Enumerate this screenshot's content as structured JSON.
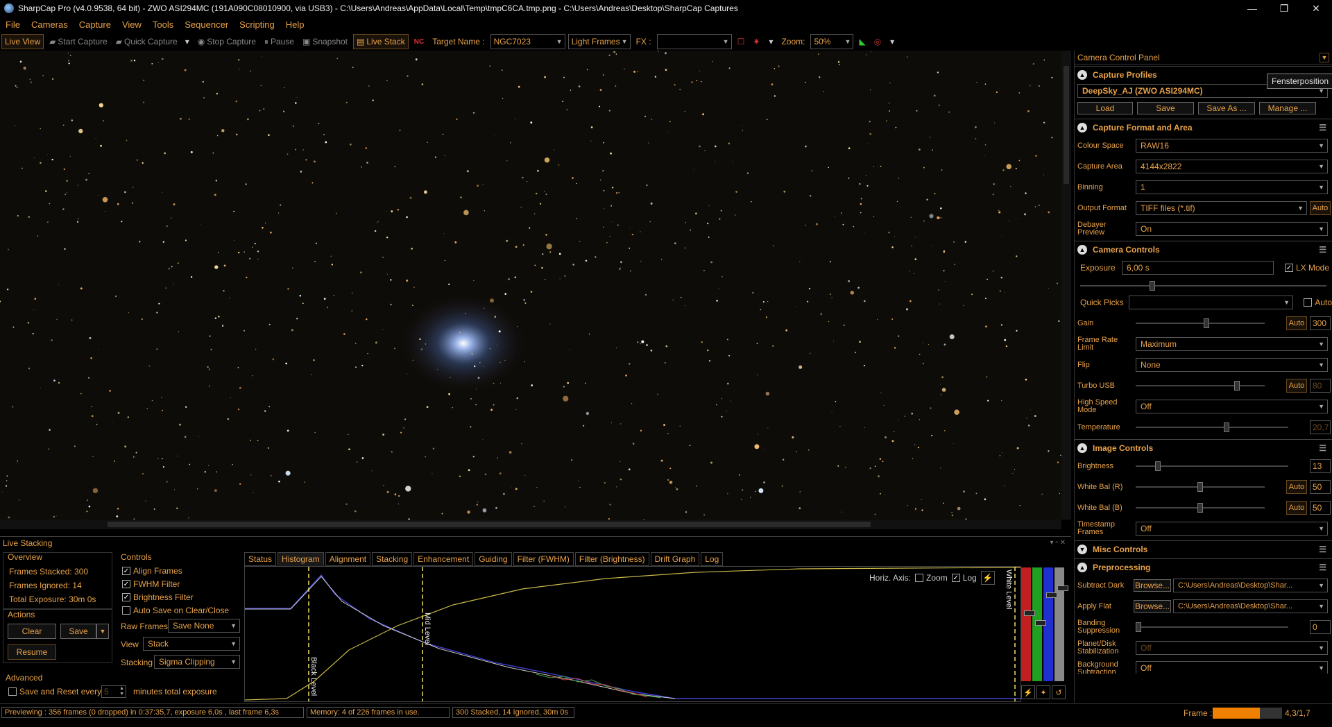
{
  "title": "SharpCap Pro (v4.0.9538, 64 bit) - ZWO ASI294MC (191A090C08010900, via USB3) - C:\\Users\\Andreas\\AppData\\Local\\Temp\\tmpC6CA.tmp.png - C:\\Users\\Andreas\\Desktop\\SharpCap Captures",
  "window_controls": [
    "—",
    "❐",
    "✕"
  ],
  "menu": [
    "File",
    "Cameras",
    "Capture",
    "View",
    "Tools",
    "Sequencer",
    "Scripting",
    "Help"
  ],
  "toolbar": {
    "live_view": "Live View",
    "start_capture": "Start Capture",
    "quick_capture": "Quick Capture",
    "stop_capture": "Stop Capture",
    "pause": "Pause",
    "snapshot": "Snapshot",
    "live_stack": "Live Stack",
    "target_name_label": "Target Name :",
    "target_name_value": "NGC7023",
    "frame_type": "Light Frames",
    "fx_label": "FX :",
    "fx_value": "",
    "zoom_label": "Zoom:",
    "zoom_value": "50%"
  },
  "camera_panel": {
    "header": "Camera Control Panel",
    "tooltip": "Fensterposition",
    "capture_profiles": {
      "title": "Capture Profiles",
      "profile": "DeepSky_AJ (ZWO ASI294MC)",
      "buttons": [
        "Load",
        "Save",
        "Save As ...",
        "Manage ..."
      ]
    },
    "capture_format": {
      "title": "Capture Format and Area",
      "colour_space_label": "Colour Space",
      "colour_space": "RAW16",
      "capture_area_label": "Capture Area",
      "capture_area": "4144x2822",
      "binning_label": "Binning",
      "binning": "1",
      "output_format_label": "Output Format",
      "output_format": "TIFF files (*.tif)",
      "output_auto": "Auto",
      "debayer_label": "Debayer Preview",
      "debayer": "On"
    },
    "camera_controls": {
      "title": "Camera Controls",
      "exposure_label": "Exposure",
      "exposure": "6,00 s",
      "lx_mode": "LX Mode",
      "quick_picks_label": "Quick Picks",
      "quick_picks": "",
      "quick_auto": "Auto",
      "gain_label": "Gain",
      "gain_auto": "Auto",
      "gain": "300",
      "gain_level": 0.55,
      "frame_rate_label": "Frame Rate Limit",
      "frame_rate": "Maximum",
      "flip_label": "Flip",
      "flip": "None",
      "turbo_label": "Turbo USB",
      "turbo_auto": "Auto",
      "turbo": "80",
      "turbo_level": 0.8,
      "high_speed_label": "High Speed Mode",
      "high_speed": "Off",
      "temperature_label": "Temperature",
      "temperature": "20,7",
      "temperature_level": 0.6
    },
    "image_controls": {
      "title": "Image Controls",
      "brightness_label": "Brightness",
      "brightness": "13",
      "brightness_level": 0.13,
      "wb_r_label": "White Bal (R)",
      "wb_r_auto": "Auto",
      "wb_r": "50",
      "wb_r_level": 0.5,
      "wb_b_label": "White Bal (B)",
      "wb_b_auto": "Auto",
      "wb_b": "50",
      "wb_b_level": 0.5,
      "timestamp_label": "Timestamp Frames",
      "timestamp": "Off"
    },
    "misc_controls": {
      "title": "Misc Controls"
    },
    "preprocessing": {
      "title": "Preprocessing",
      "subtract_dark_label": "Subtract Dark",
      "browse": "Browse...",
      "dark_path": "C:\\Users\\Andreas\\Desktop\\Shar...",
      "apply_flat_label": "Apply Flat",
      "flat_path": "C:\\Users\\Andreas\\Desktop\\Shar...",
      "banding_label": "Banding Suppression",
      "banding": "0",
      "planet_label": "Planet/Disk Stabilization",
      "planet": "Off",
      "background_label": "Background Subtraction",
      "background": "Off"
    }
  },
  "live_stacking": {
    "title": "Live Stacking",
    "overview": {
      "title": "Overview",
      "frames_stacked_label": "Frames Stacked:",
      "frames_stacked": "300",
      "frames_ignored_label": "Frames Ignored:",
      "frames_ignored": "14",
      "total_exposure_label": "Total Exposure:",
      "total_exposure": "30m 0s"
    },
    "actions": {
      "title": "Actions",
      "clear": "Clear",
      "save": "Save",
      "resume": "Resume"
    },
    "advanced": {
      "title": "Advanced",
      "save_reset": "Save and Reset every",
      "minutes": "5",
      "minutes_label": "minutes total exposure"
    },
    "controls": {
      "title": "Controls",
      "align": "Align Frames",
      "fwhm": "FWHM Filter",
      "brightness": "Brightness Filter",
      "auto_save": "Auto Save on Clear/Close",
      "raw_frames_label": "Raw Frames",
      "raw_frames": "Save None",
      "view_label": "View",
      "view": "Stack",
      "stacking_label": "Stacking",
      "stacking": "Sigma Clipping"
    },
    "tabs": [
      "Status",
      "Histogram",
      "Alignment",
      "Stacking",
      "Enhancement",
      "Guiding",
      "Filter (FWHM)",
      "Filter (Brightness)",
      "Drift Graph",
      "Log"
    ],
    "histogram": {
      "horiz_axis": "Horiz. Axis:",
      "zoom": "Zoom",
      "log": "Log",
      "black_level": "Black Level",
      "mid_level": "Mid Level",
      "white_level": "White Level"
    }
  },
  "status": {
    "preview": "Previewing : 356 frames (0 dropped) in 0:37:35,7, exposure 6,0s , last frame 6,3s",
    "memory": "Memory: 4 of 226 frames in use.",
    "stack": "300 Stacked, 14 Ignored, 30m 0s",
    "frame_label": "Frame :",
    "frame_value": "4,3/1,7",
    "frame_level": 0.68
  },
  "colors": {
    "accent": "#e8a24a",
    "background": "#000000"
  },
  "icons": [
    "app-icon",
    "camera-icon",
    "stop-icon",
    "pause-icon",
    "snapshot-icon",
    "live-stack-icon",
    "chevron-up-icon",
    "hamburger-icon"
  ]
}
